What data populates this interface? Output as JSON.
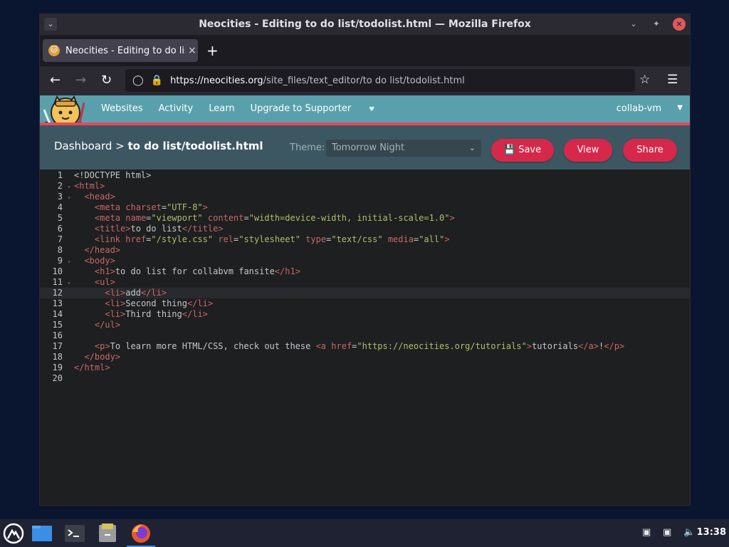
{
  "window": {
    "title": "Neocities - Editing to do list/todolist.html — Mozilla Firefox"
  },
  "browser": {
    "tab_title": "Neocities - Editing to do list/todolist.html",
    "new_tab": "+",
    "url_host": "https://neocities.org",
    "url_path": "/site_files/text_editor/to do list/todolist.html"
  },
  "site_nav": {
    "links": [
      "Websites",
      "Activity",
      "Learn",
      "Upgrade to Supporter"
    ],
    "user": "collab-vm"
  },
  "header": {
    "breadcrumb_root": "Dashboard",
    "breadcrumb_sep": " > ",
    "breadcrumb_file": "to do list/todolist.html",
    "theme_label": "Theme:",
    "theme_value": "Tomorrow Night",
    "save_label": "Save",
    "view_label": "View",
    "share_label": "Share"
  },
  "editor": {
    "active_line": 12,
    "lines": [
      "<!DOCTYPE html>",
      "<html>",
      "  <head>",
      "    <meta charset=\"UTF-8\">",
      "    <meta name=\"viewport\" content=\"width=device-width, initial-scale=1.0\">",
      "    <title>to do list</title>",
      "    <link href=\"/style.css\" rel=\"stylesheet\" type=\"text/css\" media=\"all\">",
      "  </head>",
      "  <body>",
      "    <h1>to do list for collabvm fansite</h1>",
      "    <ul>",
      "      <li>add</li>",
      "      <li>Second thing</li>",
      "      <li>Third thing</li>",
      "    </ul>",
      "",
      "    <p>To learn more HTML/CSS, check out these <a href=\"https://neocities.org/tutorials\">tutorials</a>!</p>",
      "  </body>",
      "</html>",
      ""
    ],
    "fold_lines": [
      2,
      3,
      9,
      11
    ]
  },
  "taskbar": {
    "clock": "13:38"
  },
  "colors": {
    "accent": "#d6284a",
    "site_nav": "#5aa0ac",
    "header": "#3d5762"
  }
}
